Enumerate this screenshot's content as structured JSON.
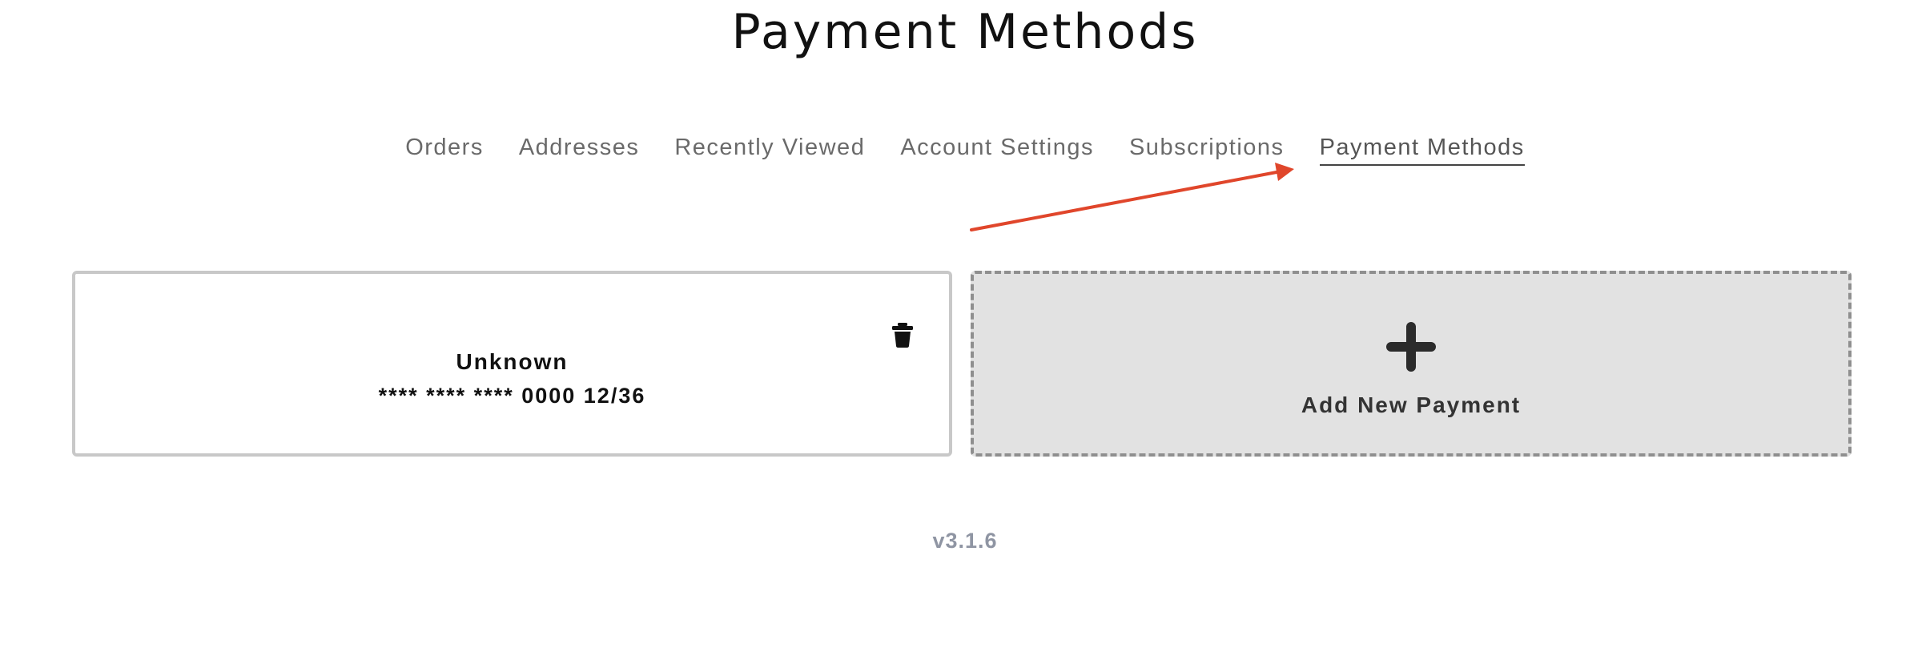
{
  "page": {
    "title": "Payment Methods"
  },
  "nav": {
    "items": [
      {
        "label": "Orders",
        "active": false
      },
      {
        "label": "Addresses",
        "active": false
      },
      {
        "label": "Recently Viewed",
        "active": false
      },
      {
        "label": "Account Settings",
        "active": false
      },
      {
        "label": "Subscriptions",
        "active": false
      },
      {
        "label": "Payment Methods",
        "active": true
      }
    ]
  },
  "payment_methods": [
    {
      "brand": "Unknown",
      "number": "**** **** **** 0000 12/36",
      "delete_icon": "trash-icon"
    }
  ],
  "add_payment": {
    "label": "Add New Payment",
    "icon": "plus-icon"
  },
  "footer": {
    "version": "v3.1.6"
  },
  "colors": {
    "annotation_arrow": "#e0462b",
    "card_border": "#c8c8c8",
    "add_card_background": "#e2e2e2",
    "add_card_border": "#8f8f8f",
    "version_text": "#8f95a3"
  }
}
